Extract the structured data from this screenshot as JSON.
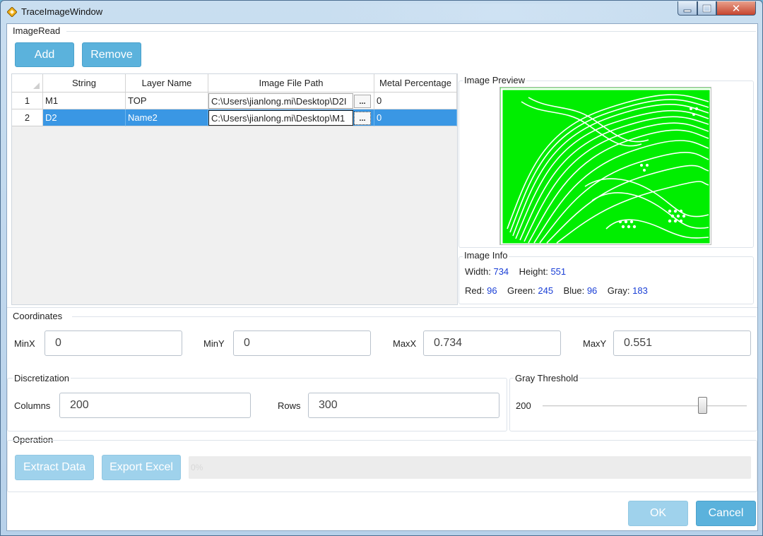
{
  "window": {
    "title": "TraceImageWindow",
    "close_glyph": "✕"
  },
  "image_read": {
    "label": "ImageRead",
    "add_button": "Add",
    "remove_button": "Remove",
    "columns": [
      "String",
      "Layer Name",
      "Image File Path",
      "Metal Percentage"
    ],
    "rows": [
      {
        "num": "1",
        "string": "M1",
        "layer": "TOP",
        "path": "C:\\Users\\jianlong.mi\\Desktop\\D2I",
        "browse": "...",
        "metal": "0",
        "selected": false
      },
      {
        "num": "2",
        "string": "D2",
        "layer": "Name2",
        "path": "C:\\Users\\jianlong.mi\\Desktop\\M1",
        "browse": "...",
        "metal": "0",
        "selected": true
      }
    ]
  },
  "preview": {
    "label": "Image Preview"
  },
  "image_info": {
    "label": "Image Info",
    "width_label": "Width:",
    "width": "734",
    "height_label": "Height:",
    "height": "551",
    "red_label": "Red:",
    "red": "96",
    "green_label": "Green:",
    "green": "245",
    "blue_label": "Blue:",
    "blue": "96",
    "gray_label": "Gray:",
    "gray": "183"
  },
  "coordinates": {
    "label": "Coordinates",
    "minx_label": "MinX",
    "minx": "0",
    "miny_label": "MinY",
    "miny": "0",
    "maxx_label": "MaxX",
    "maxx": "0.734",
    "maxy_label": "MaxY",
    "maxy": "0.551"
  },
  "discretization": {
    "label": "Discretization",
    "columns_label": "Columns",
    "columns": "200",
    "rows_label": "Rows",
    "rows": "300"
  },
  "gray_threshold": {
    "label": "Gray Threshold",
    "value": "200",
    "slider_fraction": 0.8
  },
  "operation": {
    "label": "Operation",
    "extract_button": "Extract Data",
    "export_button": "Export Excel",
    "progress_text": "0%"
  },
  "footer": {
    "ok_button": "OK",
    "cancel_button": "Cancel"
  },
  "colors": {
    "accent": "#5bb2dc",
    "disabled": "#9fd2ec",
    "selection": "#3a97e4",
    "preview_green": "#00ee00",
    "value_blue": "#1a3fd6"
  },
  "icons": [
    "app-diamond-icon",
    "minimize-icon",
    "maximize-icon",
    "close-icon"
  ]
}
